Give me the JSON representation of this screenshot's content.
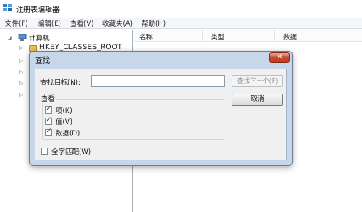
{
  "window": {
    "title": "注册表编辑器",
    "menu": [
      "文件(F)",
      "编辑(E)",
      "查看(V)",
      "收藏夹(A)",
      "帮助(H)"
    ]
  },
  "tree": {
    "root_label": "计算机",
    "first_key": "HKEY_CLASSES_ROOT"
  },
  "list": {
    "columns": [
      "名称",
      "类型",
      "数据"
    ]
  },
  "find_dialog": {
    "title": "查找",
    "close_glyph": "✕",
    "find_what_label": "查找目标(N):",
    "find_what_value": "",
    "find_next_label": "查找下一个(F)",
    "cancel_label": "取消",
    "look_at_title": "查看",
    "look_at": [
      {
        "label": "项(K)",
        "checked": true
      },
      {
        "label": "值(V)",
        "checked": true
      },
      {
        "label": "数据(D)",
        "checked": true
      }
    ],
    "match_whole_label": "全字匹配(W)",
    "match_whole_checked": false
  },
  "icons": {
    "app": "registry-editor-icon",
    "computer": "computer-icon",
    "folder": "folder-icon",
    "close": "close-icon"
  },
  "colors": {
    "dialog_frame": "#c7d6e8",
    "close_button": "#c8452a",
    "dialog_body": "#f0f0f0"
  }
}
